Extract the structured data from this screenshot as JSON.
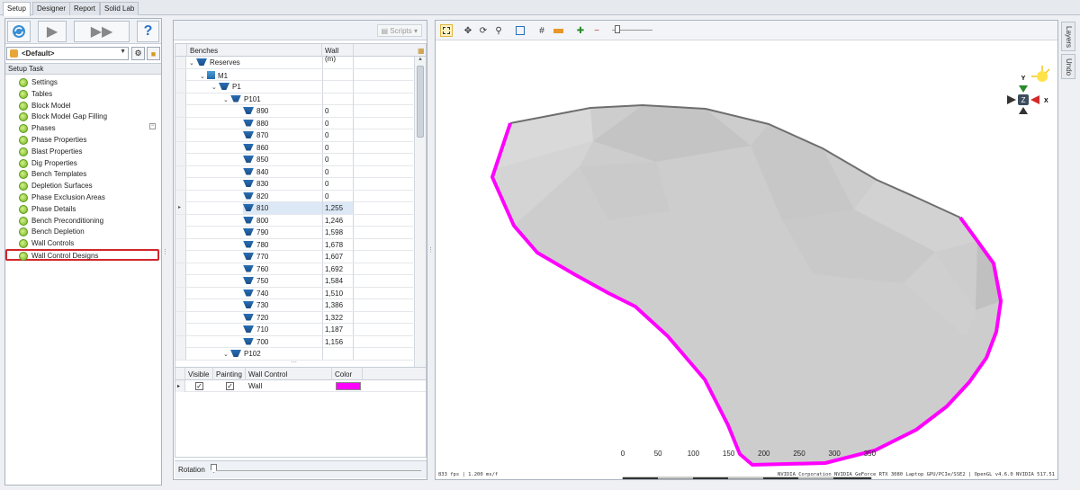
{
  "tabs": [
    "Setup",
    "Designer",
    "Report",
    "Solid Lab"
  ],
  "left_panel": {
    "profile": "<Default>",
    "section_title": "Setup Task",
    "tasks": [
      "Settings",
      "Tables",
      "Block Model",
      "Block Model Gap Filling",
      "Phases",
      "Phase Properties",
      "Blast Properties",
      "Dig Properties",
      "Bench Templates",
      "Depletion Surfaces",
      "Phase Exclusion Areas",
      "Phase Details",
      "Bench Preconditioning",
      "Bench Depletion",
      "Wall Controls",
      "Wall Control Designs"
    ],
    "selected_task": "Wall Control Designs"
  },
  "middle_panel": {
    "scripts_label": "Scripts",
    "columns": [
      "Benches",
      "Wall (m)"
    ],
    "tree": [
      {
        "name": "Reserves",
        "wall": "",
        "level": 0
      },
      {
        "name": "M1",
        "wall": "",
        "level": 1
      },
      {
        "name": "P1",
        "wall": "",
        "level": 2
      },
      {
        "name": "P101",
        "wall": "",
        "level": 3
      },
      {
        "name": "890",
        "wall": "0",
        "level": 4
      },
      {
        "name": "880",
        "wall": "0",
        "level": 4
      },
      {
        "name": "870",
        "wall": "0",
        "level": 4
      },
      {
        "name": "860",
        "wall": "0",
        "level": 4
      },
      {
        "name": "850",
        "wall": "0",
        "level": 4
      },
      {
        "name": "840",
        "wall": "0",
        "level": 4
      },
      {
        "name": "830",
        "wall": "0",
        "level": 4
      },
      {
        "name": "820",
        "wall": "0",
        "level": 4
      },
      {
        "name": "810",
        "wall": "1,255",
        "level": 4
      },
      {
        "name": "800",
        "wall": "1,246",
        "level": 4
      },
      {
        "name": "790",
        "wall": "1,598",
        "level": 4
      },
      {
        "name": "780",
        "wall": "1,678",
        "level": 4
      },
      {
        "name": "770",
        "wall": "1,607",
        "level": 4
      },
      {
        "name": "760",
        "wall": "1,692",
        "level": 4
      },
      {
        "name": "750",
        "wall": "1,584",
        "level": 4
      },
      {
        "name": "740",
        "wall": "1,510",
        "level": 4
      },
      {
        "name": "730",
        "wall": "1,386",
        "level": 4
      },
      {
        "name": "720",
        "wall": "1,322",
        "level": 4
      },
      {
        "name": "710",
        "wall": "1,187",
        "level": 4
      },
      {
        "name": "700",
        "wall": "1,156",
        "level": 4
      },
      {
        "name": "P102",
        "wall": "",
        "level": 3
      }
    ],
    "current_row": "810",
    "wall_table": {
      "columns": [
        "Visible",
        "Painting",
        "Wall Control",
        "Color"
      ],
      "rows": [
        {
          "visible": true,
          "painting": true,
          "name": "Wall",
          "color": "#ff00ff"
        }
      ]
    },
    "rotation_label": "Rotation"
  },
  "viewer": {
    "axis_labels": {
      "y": "Y",
      "x": "X",
      "z": "Z"
    },
    "scale_ticks": [
      "0",
      "50",
      "100",
      "150",
      "200",
      "250",
      "300",
      "350"
    ],
    "fps": "833 fps | 1.200 ms/f",
    "renderer": "NVIDIA Corporation NVIDIA GeForce RTX 3080 Laptop GPU/PCIe/SSE2 | OpenGL v4.6.0 NVIDIA 517.51",
    "wall_color": "#ff00ff",
    "edge_color": "#6e6e6e",
    "fill_color": "#cdcdcd"
  },
  "side_tabs": [
    "Layers",
    "Undo"
  ]
}
